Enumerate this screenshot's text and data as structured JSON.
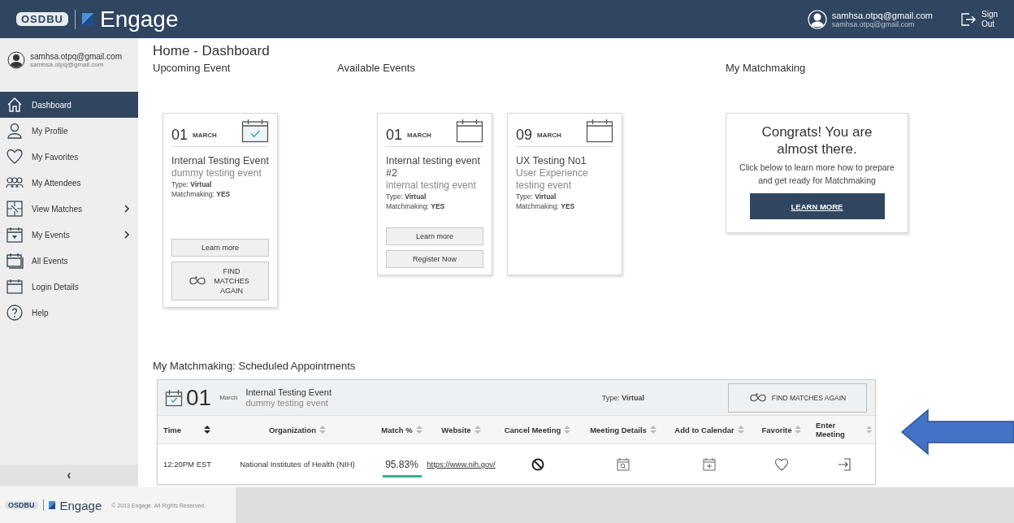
{
  "header": {
    "logo_mark": "OSDBU",
    "logo_text": "Engage",
    "user_name": "samhsa.otpq@gmail.com",
    "user_email": "samhsa.otpq@gmail.com",
    "sign_out": "Sign Out"
  },
  "sidebar": {
    "user_name": "samhsa.otpq@gmail.com",
    "user_email": "samhsa.otpq@gmail.com",
    "items": [
      {
        "label": "Dashboard",
        "kind": "home",
        "selected": true,
        "submenu": false
      },
      {
        "label": "My Profile",
        "kind": "person",
        "selected": false,
        "submenu": false
      },
      {
        "label": "My Favorites",
        "kind": "heart",
        "selected": false,
        "submenu": false
      },
      {
        "label": "My Attendees",
        "kind": "people",
        "selected": false,
        "submenu": false
      },
      {
        "label": "View Matches",
        "kind": "puzzle",
        "selected": false,
        "submenu": true
      },
      {
        "label": "My Events",
        "kind": "calendar-down",
        "selected": false,
        "submenu": true
      },
      {
        "label": "All Events",
        "kind": "calendar-stack",
        "selected": false,
        "submenu": false
      },
      {
        "label": "Login Details",
        "kind": "calendar",
        "selected": false,
        "submenu": false
      },
      {
        "label": "Help",
        "kind": "help",
        "selected": false,
        "submenu": false
      }
    ],
    "collapse": "‹"
  },
  "page_title": "Home - Dashboard",
  "upcoming": {
    "heading": "Upcoming Event",
    "events": [
      {
        "day": "01",
        "month": "MARCH",
        "title": "Internal Testing Event",
        "subtitle": "dummy testing event",
        "type": "Type: **Virtual**",
        "matchmaking": "Matchmaking: **YES**",
        "registered": true,
        "buttons": [
          {
            "label": "Learn more",
            "kind": "plain"
          },
          {
            "label": "FIND MATCHES AGAIN",
            "kind": "matches"
          }
        ]
      }
    ]
  },
  "available": {
    "heading": "Available Events",
    "events": [
      {
        "day": "01",
        "month": "MARCH",
        "title": "Internal testing event #2",
        "subtitle": "internal testing event",
        "type": "Type: **Virtual**",
        "matchmaking": "Matchmaking: **YES**",
        "registered": false,
        "buttons": [
          {
            "label": "Learn more",
            "kind": "plain"
          },
          {
            "label": "Register Now",
            "kind": "plain"
          }
        ]
      },
      {
        "day": "09",
        "month": "MARCH",
        "title": "UX Testing No1",
        "subtitle": "User Experience testing event",
        "type": "Type: **Virtual**",
        "matchmaking": "Matchmaking: **YES**",
        "registered": false
      }
    ]
  },
  "matchmaking": {
    "heading": "My Matchmaking",
    "title": "Congrats! You are almost there.",
    "text": "Click below to learn more how to prepare and get ready for Matchmaking",
    "button": "LEARN MORE"
  },
  "appointments": {
    "heading": "My Matchmaking: Scheduled Appointments",
    "event": {
      "day": "01",
      "month": "March",
      "title": "Internal Testing Event",
      "subtitle": "dummy testing event",
      "type": "Type: **Virtual**",
      "registered": true,
      "button": "FIND MATCHES AGAIN"
    },
    "columns": [
      {
        "label": "Time",
        "sorted": true
      },
      {
        "label": "Organization",
        "sorted": false
      },
      {
        "label": "Match %",
        "sorted": false
      },
      {
        "label": "Website",
        "sorted": false
      },
      {
        "label": "Cancel Meeting",
        "sorted": false
      },
      {
        "label": "Meeting Details",
        "sorted": false
      },
      {
        "label": "Add to Calendar",
        "sorted": false
      },
      {
        "label": "Favorite",
        "sorted": false
      },
      {
        "label": "Enter Meeting",
        "sorted": false
      }
    ],
    "rows": [
      {
        "time": "12:20PM EST",
        "organization": "National Institutes of Health (NIH)",
        "match": "95.83%",
        "website": "https://www.nih.gov/",
        "favorite": false
      }
    ]
  },
  "footer": {
    "logo_mark": "OSDBU",
    "logo_text": "Engage",
    "copyright": "© 2013 Engage. All Rights Reserved."
  }
}
